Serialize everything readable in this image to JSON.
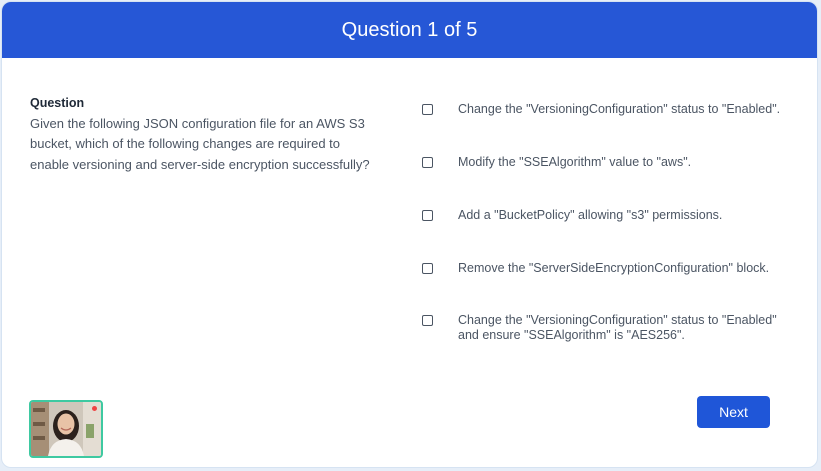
{
  "header": {
    "title": "Question 1 of 5",
    "color": "#2657d6"
  },
  "question": {
    "heading": "Question",
    "text": "Given the following JSON configuration file for an AWS S3 bucket, which of the following changes are required to enable versioning and server-side encryption successfully?"
  },
  "options": [
    {
      "label": "Change the \"VersioningConfiguration\" status to \"Enabled\"."
    },
    {
      "label": "Modify the \"SSEAlgorithm\" value to \"aws\"."
    },
    {
      "label": "Add a \"BucketPolicy\" allowing \"s3\" permissions."
    },
    {
      "label": "Remove the \"ServerSideEncryptionConfiguration\" block."
    },
    {
      "label": "Change the \"VersioningConfiguration\" status to \"Enabled\" and ensure \"SSEAlgorithm\" is \"AES256\"."
    }
  ],
  "footer": {
    "next_label": "Next",
    "next_color": "#1f56d8"
  },
  "webcam": {
    "icon": "webcam-preview",
    "border_color": "#3ec9a1",
    "recording_color": "#ef4444"
  }
}
